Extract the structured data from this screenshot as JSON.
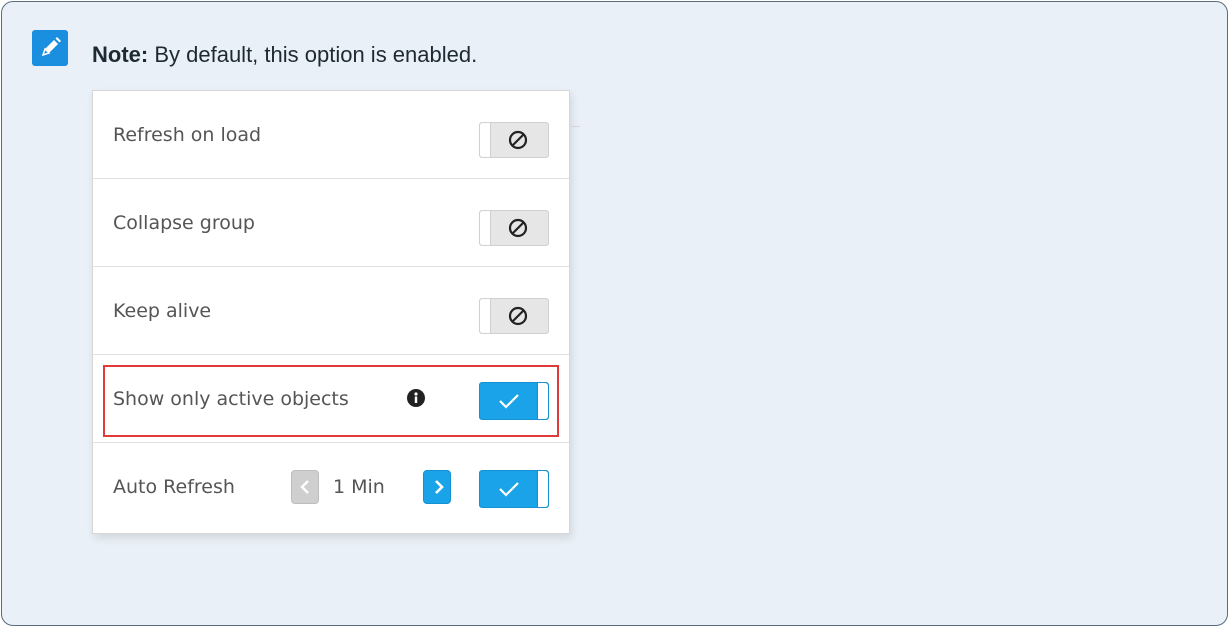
{
  "note": {
    "bold_label": "Note:",
    "text": "By default, this option is enabled.",
    "icon": "pencil-icon"
  },
  "panel": {
    "rows": [
      {
        "label": "Refresh on load",
        "toggle": "off"
      },
      {
        "label": "Collapse group",
        "toggle": "off"
      },
      {
        "label": "Keep alive",
        "toggle": "off"
      },
      {
        "label": "Show only active objects",
        "toggle": "on",
        "highlighted": true,
        "info_icon": "info-icon"
      },
      {
        "label": "Auto Refresh",
        "toggle": "on",
        "stepper_value": "1 Min"
      }
    ]
  },
  "colors": {
    "accent": "#1aa3e8",
    "highlight": "#e03a3a",
    "note_background": "#e9f0f7",
    "note_icon": "#1a8fe0"
  }
}
